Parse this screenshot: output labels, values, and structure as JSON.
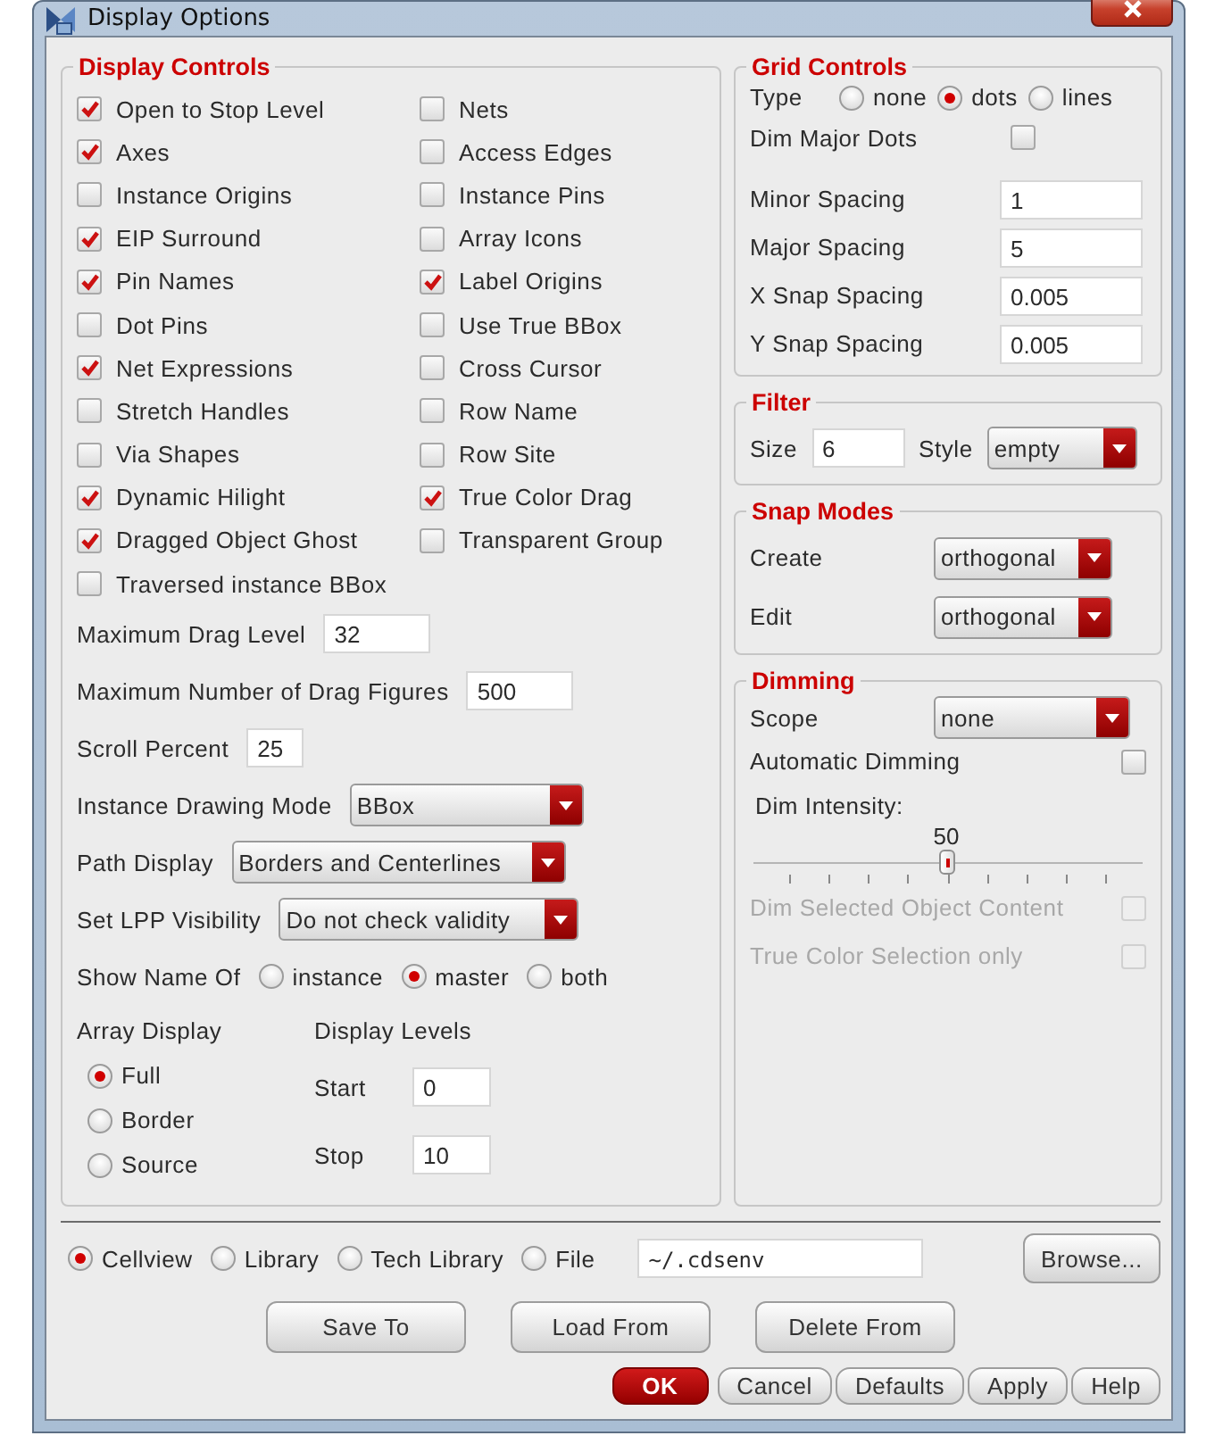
{
  "window": {
    "title": "Display Options"
  },
  "display_controls": {
    "title": "Display Controls",
    "checkboxes": [
      {
        "label": "Open to Stop Level",
        "checked": true
      },
      {
        "label": "Nets",
        "checked": false
      },
      {
        "label": "Axes",
        "checked": true
      },
      {
        "label": "Access Edges",
        "checked": false
      },
      {
        "label": "Instance Origins",
        "checked": false
      },
      {
        "label": "Instance Pins",
        "checked": false
      },
      {
        "label": "EIP Surround",
        "checked": true
      },
      {
        "label": "Array Icons",
        "checked": false
      },
      {
        "label": "Pin Names",
        "checked": true
      },
      {
        "label": "Label Origins",
        "checked": true
      },
      {
        "label": "Dot Pins",
        "checked": false
      },
      {
        "label": "Use True BBox",
        "checked": false
      },
      {
        "label": "Net Expressions",
        "checked": true
      },
      {
        "label": "Cross Cursor",
        "checked": false
      },
      {
        "label": "Stretch Handles",
        "checked": false
      },
      {
        "label": "Row Name",
        "checked": false
      },
      {
        "label": "Via Shapes",
        "checked": false
      },
      {
        "label": "Row Site",
        "checked": false
      },
      {
        "label": "Dynamic Hilight",
        "checked": true
      },
      {
        "label": "True Color Drag",
        "checked": true
      },
      {
        "label": "Dragged Object Ghost",
        "checked": true
      },
      {
        "label": "Transparent Group",
        "checked": false
      },
      {
        "label": "Traversed instance BBox",
        "checked": false
      }
    ],
    "fields": [
      {
        "label": "Maximum Drag Level",
        "value": "32",
        "kind": "text"
      },
      {
        "label": "Maximum Number of Drag Figures",
        "value": "500",
        "kind": "text"
      },
      {
        "label": "Scroll Percent",
        "value": "25",
        "kind": "text"
      },
      {
        "label": "Instance Drawing Mode",
        "value": "BBox",
        "kind": "select"
      },
      {
        "label": "Path Display",
        "value": "Borders and Centerlines",
        "kind": "select"
      },
      {
        "label": "Set LPP Visibility",
        "value": "Do not check validity",
        "kind": "select"
      }
    ],
    "show_name_of": {
      "label": "Show Name Of",
      "options": [
        {
          "label": "instance",
          "selected": false
        },
        {
          "label": "master",
          "selected": true
        },
        {
          "label": "both",
          "selected": false
        }
      ]
    },
    "array_display": {
      "label": "Array Display",
      "options": [
        {
          "label": "Full",
          "selected": true
        },
        {
          "label": "Border",
          "selected": false
        },
        {
          "label": "Source",
          "selected": false
        }
      ]
    },
    "display_levels": {
      "label": "Display Levels",
      "fields": [
        {
          "label": "Start",
          "value": "0"
        },
        {
          "label": "Stop",
          "value": "10"
        }
      ]
    }
  },
  "grid_controls": {
    "title": "Grid Controls",
    "type": {
      "label": "Type",
      "options": [
        {
          "label": "none",
          "selected": false
        },
        {
          "label": "dots",
          "selected": true
        },
        {
          "label": "lines",
          "selected": false
        }
      ]
    },
    "checkboxes": [
      {
        "label": "Dim Major Dots",
        "checked": false
      }
    ],
    "fields": [
      {
        "label": "Minor Spacing",
        "value": "1"
      },
      {
        "label": "Major Spacing",
        "value": "5"
      },
      {
        "label": "X Snap Spacing",
        "value": "0.005"
      },
      {
        "label": "Y Snap Spacing",
        "value": "0.005"
      }
    ]
  },
  "filter": {
    "title": "Filter",
    "fields": [
      {
        "label": "Size",
        "value": "6",
        "kind": "text"
      },
      {
        "label": "Style",
        "value": "empty",
        "kind": "select"
      }
    ]
  },
  "snap_modes": {
    "title": "Snap Modes",
    "fields": [
      {
        "label": "Create",
        "value": "orthogonal",
        "kind": "select"
      },
      {
        "label": "Edit",
        "value": "orthogonal",
        "kind": "select"
      }
    ]
  },
  "dimming": {
    "title": "Dimming",
    "items": [
      {
        "kind": "select",
        "label": "Scope",
        "value": "none"
      },
      {
        "kind": "checkbox",
        "label": "Automatic Dimming",
        "checked": false,
        "disabled": false
      },
      {
        "kind": "slider",
        "label": "Dim Intensity:",
        "reading": "50",
        "level": 0.5
      },
      {
        "kind": "checkbox",
        "label": "Dim Selected Object Content",
        "checked": false,
        "disabled": true
      },
      {
        "kind": "checkbox",
        "label": "True Color Selection only",
        "checked": false,
        "disabled": true
      }
    ]
  },
  "source": {
    "options": [
      {
        "label": "Cellview",
        "selected": true
      },
      {
        "label": "Library",
        "selected": false
      },
      {
        "label": "Tech Library",
        "selected": false
      },
      {
        "label": "File",
        "selected": false
      }
    ],
    "path": "~/.cdsenv",
    "browse": "Browse..."
  },
  "actions": [
    "Save To",
    "Load From",
    "Delete From"
  ],
  "buttons": [
    {
      "label": "OK",
      "kind": "primary"
    },
    {
      "label": "Cancel",
      "kind": "normal"
    },
    {
      "label": "Defaults",
      "kind": "normal"
    },
    {
      "label": "Apply",
      "kind": "normal"
    },
    {
      "label": "Help",
      "kind": "normal"
    }
  ]
}
